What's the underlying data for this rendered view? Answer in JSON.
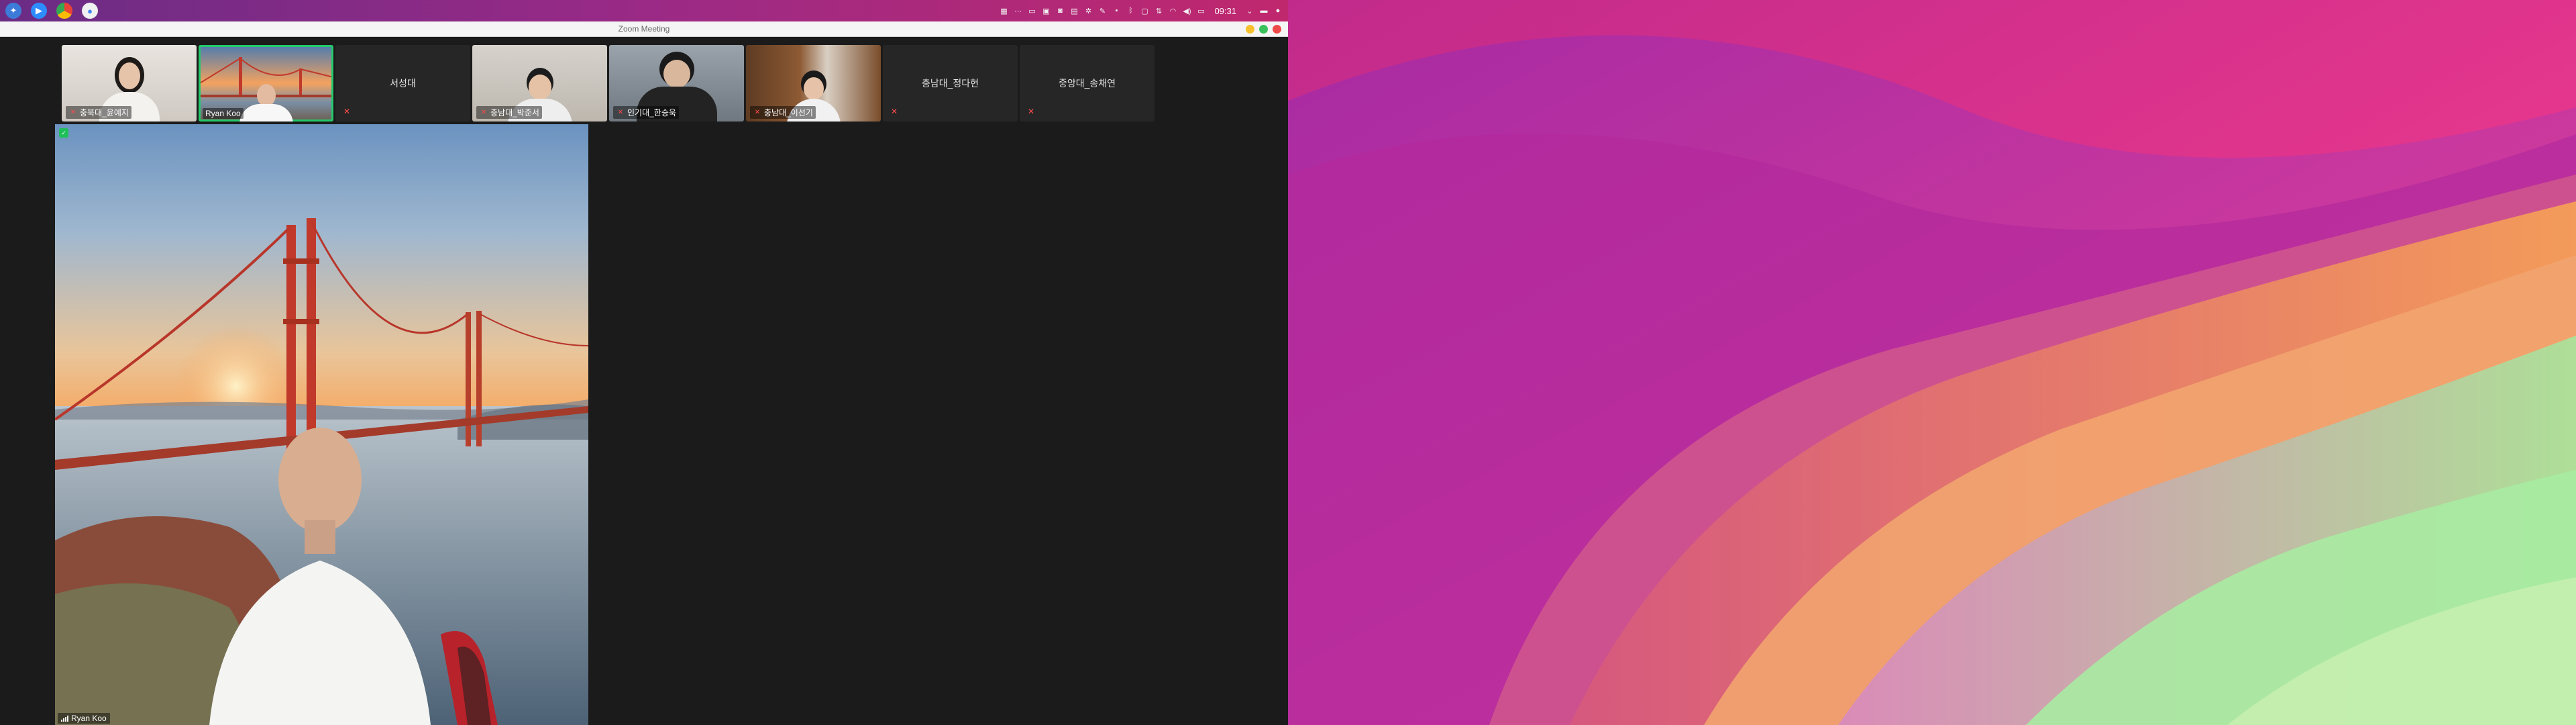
{
  "system_panel": {
    "clock": "09:31",
    "app_icons": [
      "kde-menu-icon",
      "zoom-icon",
      "chrome-icon",
      "chrome-alt-icon"
    ]
  },
  "window": {
    "title": "Zoom Meeting"
  },
  "gallery": [
    {
      "name": "충북대_윤예지",
      "has_video": true,
      "muted": true,
      "active": false
    },
    {
      "name": "Ryan Koo",
      "has_video": true,
      "muted": false,
      "active": true
    },
    {
      "name": "서성대",
      "has_video": false,
      "muted": true,
      "active": false
    },
    {
      "name": "충남대_박준서",
      "has_video": true,
      "muted": true,
      "active": false
    },
    {
      "name": "인기대_한승욱",
      "has_video": true,
      "muted": true,
      "active": false
    },
    {
      "name": "충남대_이선기",
      "has_video": true,
      "muted": true,
      "active": false
    },
    {
      "name": "충남대_정다현",
      "has_video": false,
      "muted": true,
      "active": false
    },
    {
      "name": "중앙대_송채연",
      "has_video": false,
      "muted": true,
      "active": false
    }
  ],
  "main_speaker": {
    "name": "Ryan Koo"
  },
  "colors": {
    "active_border": "#24c86b",
    "mute_red": "#ff4a4a",
    "panel_gradient_start": "#6a2c85",
    "panel_gradient_end": "#c0286e"
  }
}
